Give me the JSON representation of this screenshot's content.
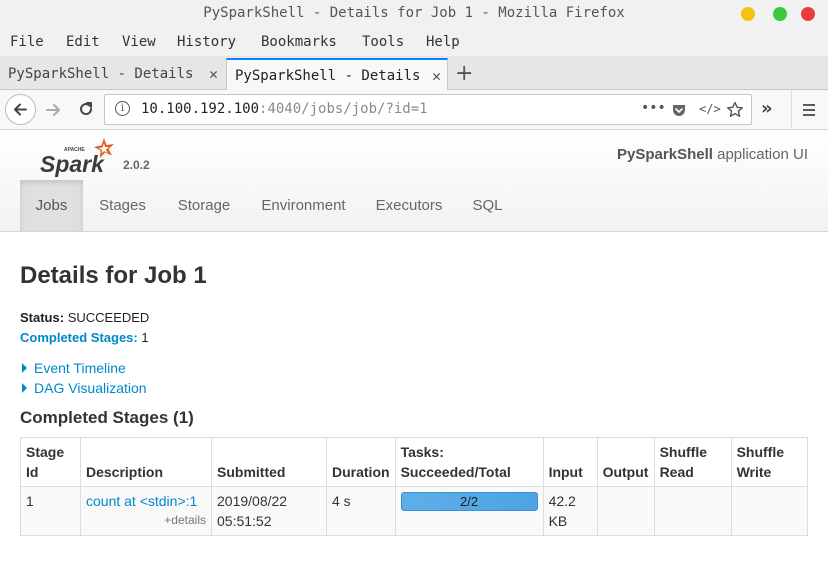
{
  "window": {
    "title": "PySparkShell - Details for Job 1 - Mozilla Firefox"
  },
  "menu": [
    "File",
    "Edit",
    "View",
    "History",
    "Bookmarks",
    "Tools",
    "Help"
  ],
  "tabs": [
    {
      "label": "PySparkShell - Details for Job 1",
      "active": false
    },
    {
      "label": "PySparkShell - Details for Job 1",
      "active": true
    }
  ],
  "urlbar": {
    "host": "10.100.192.100",
    "rest": ":4040/jobs/job/?id=1"
  },
  "spark": {
    "version": "2.0.2",
    "app_name_bold": "PySparkShell",
    "app_name_suffix": " application UI",
    "nav": [
      "Jobs",
      "Stages",
      "Storage",
      "Environment",
      "Executors",
      "SQL"
    ],
    "active_nav": "Jobs"
  },
  "page": {
    "title": "Details for Job 1",
    "status_label": "Status:",
    "status_value": "SUCCEEDED",
    "completed_label": "Completed Stages:",
    "completed_value": "1",
    "event_timeline": "Event Timeline",
    "dag_visualization": "DAG Visualization",
    "section_title": "Completed Stages (1)"
  },
  "table": {
    "headers": {
      "stage_id_1": "Stage",
      "stage_id_2": "Id",
      "description": "Description",
      "submitted": "Submitted",
      "duration": "Duration",
      "tasks_1": "Tasks:",
      "tasks_2": "Succeeded/Total",
      "input": "Input",
      "output": "Output",
      "shuffle_read_1": "Shuffle",
      "shuffle_read_2": "Read",
      "shuffle_write_1": "Shuffle",
      "shuffle_write_2": "Write"
    },
    "rows": [
      {
        "stage_id": "1",
        "description": "count at <stdin>:1",
        "details": "+details",
        "submitted_date": "2019/08/22",
        "submitted_time": "05:51:52",
        "duration": "4 s",
        "tasks": "2/2",
        "tasks_progress": 1.0,
        "input_1": "42.2",
        "input_2": "KB",
        "output": "",
        "shuffle_read": "",
        "shuffle_write": ""
      }
    ]
  }
}
